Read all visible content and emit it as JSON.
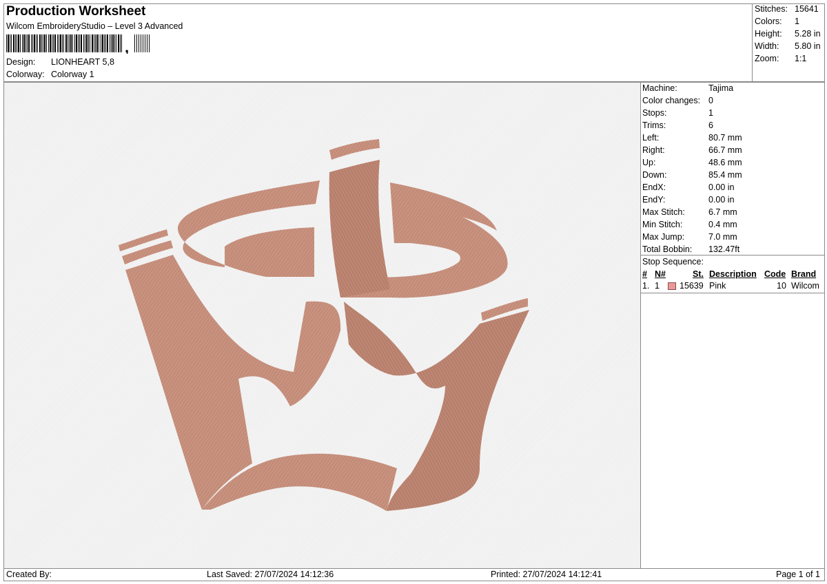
{
  "header": {
    "title": "Production Worksheet",
    "subtitle": "Wilcom EmbroideryStudio – Level 3 Advanced",
    "barcode_comma": ",",
    "design_label": "Design:",
    "design_value": "LIONHEART 5,8",
    "colorway_label": "Colorway:",
    "colorway_value": "Colorway 1"
  },
  "summary": [
    {
      "label": "Stitches:",
      "value": "15641"
    },
    {
      "label": "Colors:",
      "value": "1"
    },
    {
      "label": "Height:",
      "value": "5.28 in"
    },
    {
      "label": "Width:",
      "value": "5.80 in"
    },
    {
      "label": "Zoom:",
      "value": "1:1"
    }
  ],
  "properties": [
    {
      "label": "Machine:",
      "value": "Tajima"
    },
    {
      "label": "Color changes:",
      "value": "0"
    },
    {
      "label": "Stops:",
      "value": "1"
    },
    {
      "label": "Trims:",
      "value": "6"
    },
    {
      "label": "Left:",
      "value": "80.7 mm"
    },
    {
      "label": "Right:",
      "value": "66.7 mm"
    },
    {
      "label": "Up:",
      "value": "48.6 mm"
    },
    {
      "label": "Down:",
      "value": "85.4 mm"
    },
    {
      "label": "EndX:",
      "value": "0.00 in"
    },
    {
      "label": "EndY:",
      "value": "0.00 in"
    },
    {
      "label": "Max Stitch:",
      "value": "6.7 mm"
    },
    {
      "label": "Min Stitch:",
      "value": "0.4 mm"
    },
    {
      "label": "Max Jump:",
      "value": "7.0 mm"
    },
    {
      "label": "Total Bobbin:",
      "value": "132.47ft"
    }
  ],
  "stop_sequence": {
    "title": "Stop Sequence:",
    "headers": {
      "num": "#",
      "n": "N#",
      "st": "St.",
      "desc": "Description",
      "code": "Code",
      "brand": "Brand"
    },
    "rows": [
      {
        "num": "1.",
        "n": "1",
        "st": "15639",
        "desc": "Pink",
        "code": "10",
        "brand": "Wilcom",
        "color": "#e89a9a"
      }
    ]
  },
  "design_colors": {
    "thread": "#c9927f",
    "thread_dark": "#a8705f",
    "background": "#efefef"
  },
  "footer": {
    "created_by": "Created By:",
    "last_saved": "Last Saved: 27/07/2024 14:12:36",
    "printed": "Printed: 27/07/2024 14:12:41",
    "page": "Page 1 of 1"
  }
}
